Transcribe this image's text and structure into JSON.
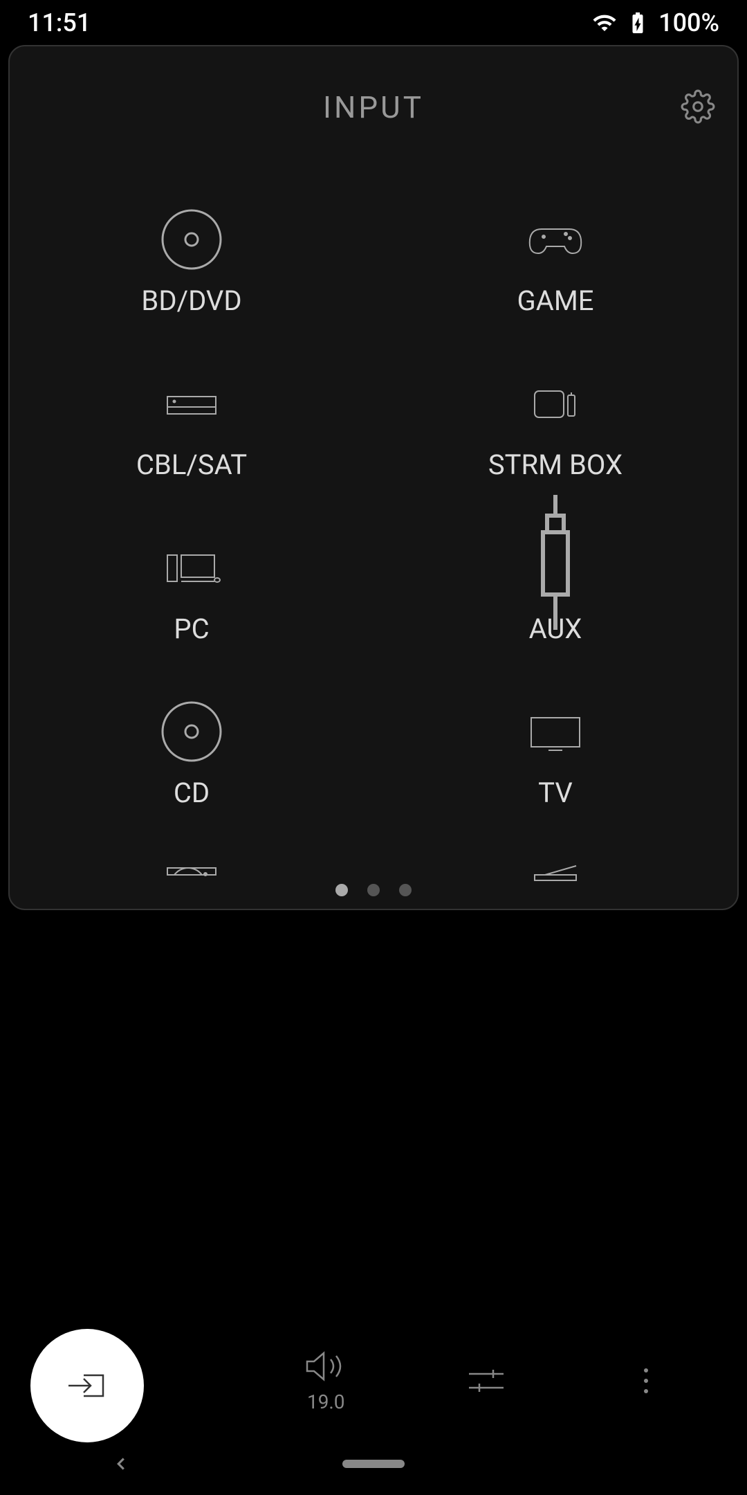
{
  "status": {
    "time": "11:51",
    "battery": "100%"
  },
  "panel": {
    "title": "INPUT"
  },
  "inputs": [
    {
      "label": "BD/DVD",
      "icon": "disc"
    },
    {
      "label": "GAME",
      "icon": "gamepad"
    },
    {
      "label": "CBL/SAT",
      "icon": "cable-box"
    },
    {
      "label": "STRM BOX",
      "icon": "stream-box"
    },
    {
      "label": "PC",
      "icon": "pc"
    },
    {
      "label": "AUX",
      "icon": "aux-jack"
    },
    {
      "label": "CD",
      "icon": "disc"
    },
    {
      "label": "TV",
      "icon": "tv"
    }
  ],
  "page_indicator": {
    "active": 0,
    "total": 3
  },
  "bottom_bar": {
    "volume": "19.0"
  }
}
